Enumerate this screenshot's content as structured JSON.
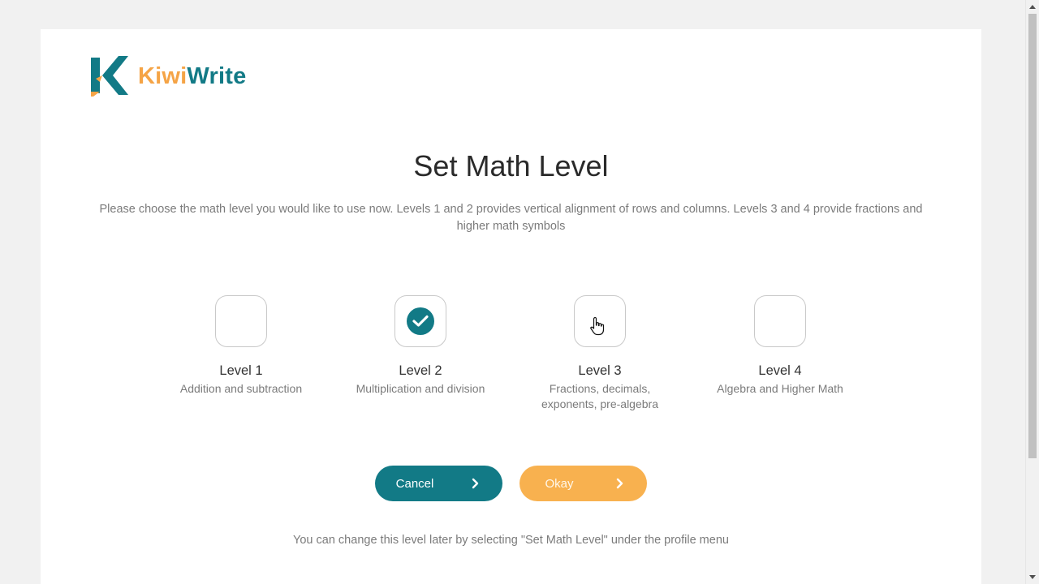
{
  "brand": {
    "name_part1": "Kiwi",
    "name_part2": "Write",
    "color_teal": "#127a86",
    "color_orange": "#f5a446"
  },
  "dialog": {
    "title": "Set Math Level",
    "description": "Please choose the math level you would like to use now. Levels 1 and 2 provides vertical alignment of rows and columns. Levels 3 and 4 provide fractions and higher math symbols",
    "levels": [
      {
        "name": "Level 1",
        "description": "Addition and subtraction",
        "selected": false
      },
      {
        "name": "Level 2",
        "description": "Multiplication and division",
        "selected": true
      },
      {
        "name": "Level 3",
        "description": "Fractions, decimals, exponents, pre-algebra",
        "selected": false
      },
      {
        "name": "Level 4",
        "description": "Algebra and Higher Math",
        "selected": false
      }
    ],
    "cancel_label": "Cancel",
    "okay_label": "Okay",
    "footer_note": "You can change this level later by selecting \"Set Math Level\" under the profile menu"
  },
  "icons": {
    "selected_level": "check-icon",
    "button_arrow": "chevron-right-icon",
    "pointer": "hand-pointer-icon"
  }
}
